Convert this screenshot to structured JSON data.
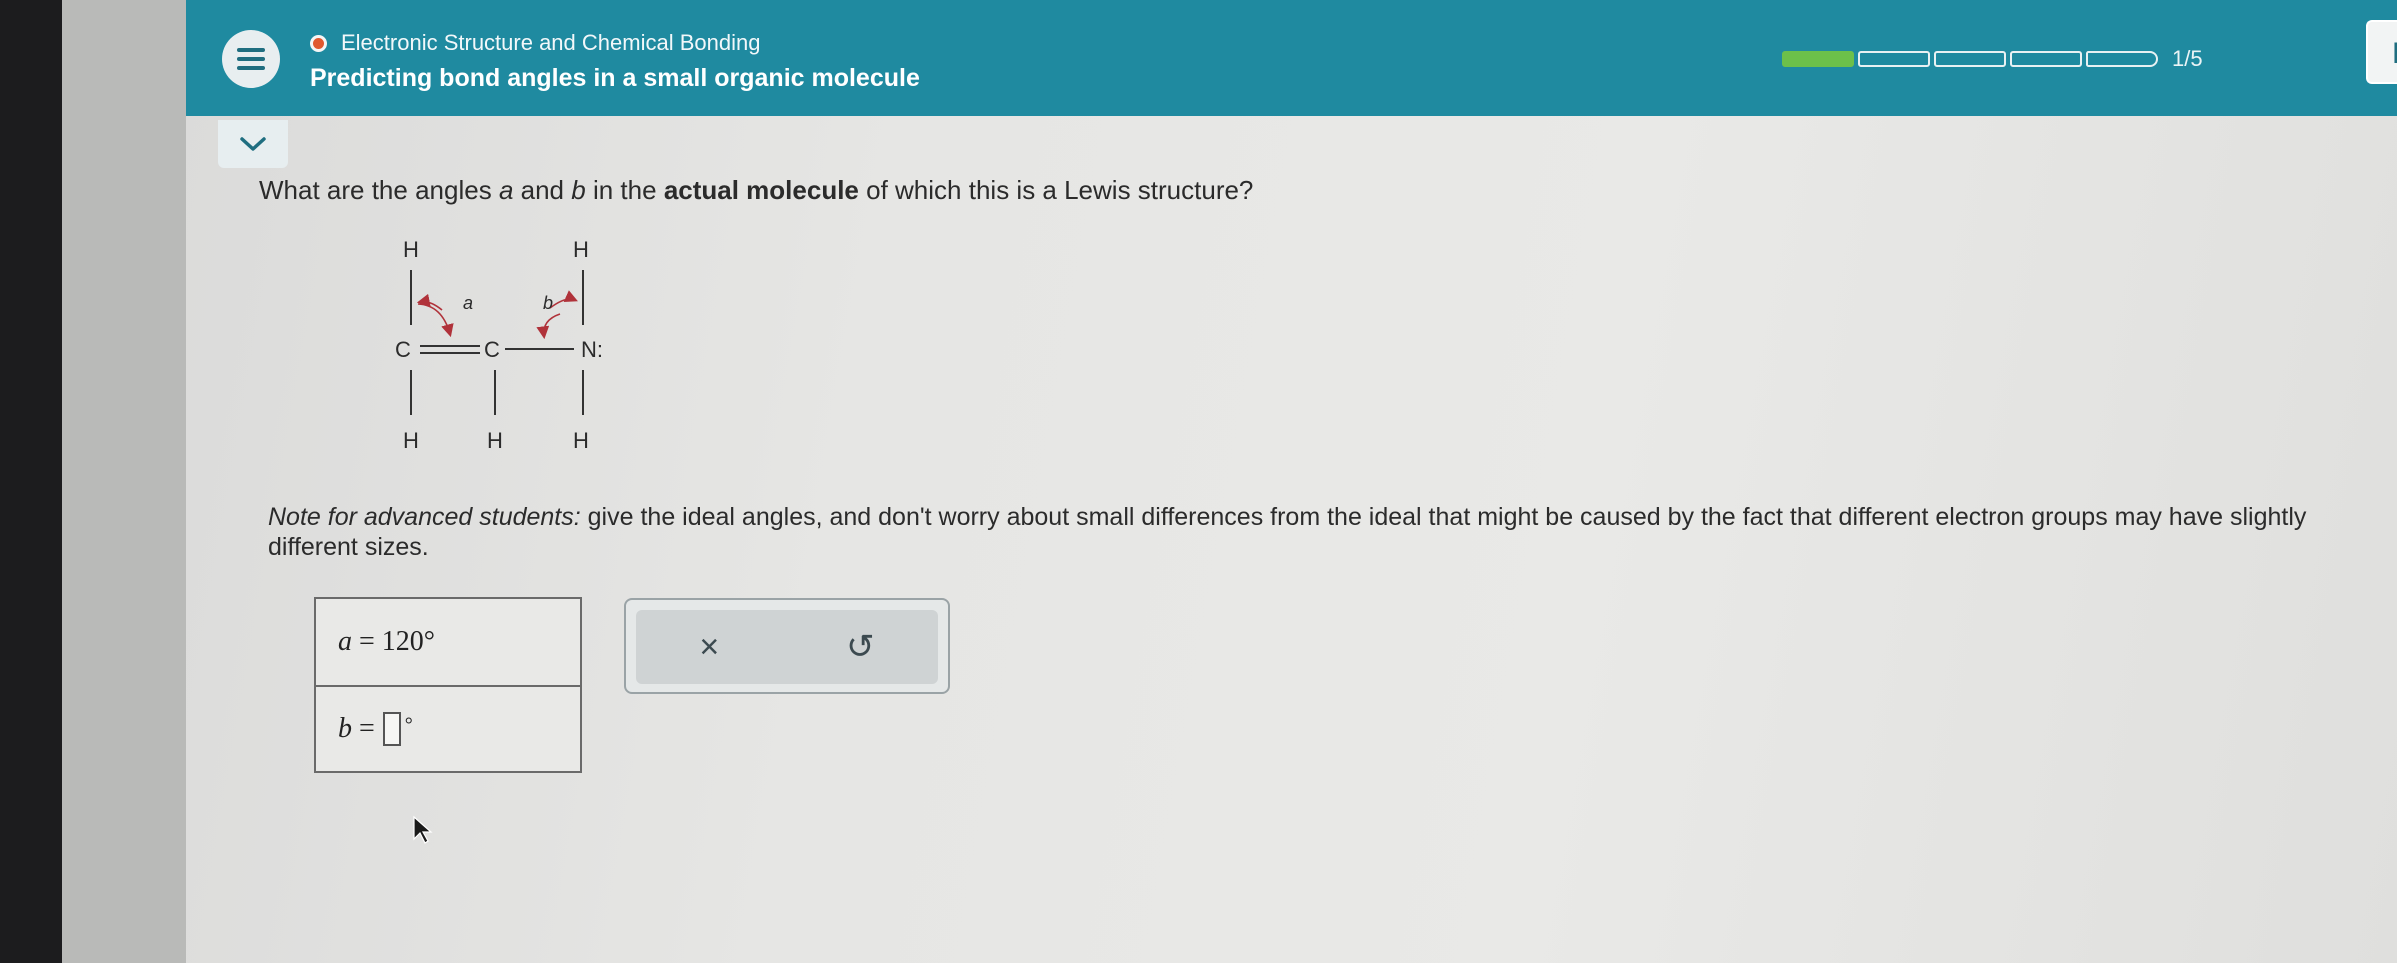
{
  "header": {
    "topic": "Electronic Structure and Chemical Bonding",
    "subtitle": "Predicting bond angles in a small organic molecule",
    "progress": {
      "completed": 1,
      "total": 5,
      "label": "1/5"
    },
    "right_button_label": "Prak"
  },
  "question": {
    "prefix": "What are the angles",
    "var_a": "a",
    "and": "and",
    "var_b": "b",
    "mid": "in the",
    "bold": "actual molecule",
    "suffix": "of which this is a Lewis structure?"
  },
  "molecule": {
    "atoms": [
      "H",
      "H",
      "C",
      "C",
      "N:",
      "H",
      "H",
      "H"
    ],
    "angle_labels": [
      "a",
      "b"
    ]
  },
  "note": {
    "lead": "Note for advanced students:",
    "text": "give the ideal angles, and don't worry about small differences from the ideal that might be caused by the fact that different electron groups may have slightly different sizes."
  },
  "answers": {
    "a_var": "a",
    "a_value": "= 120°",
    "b_var": "b",
    "b_equals": "=",
    "b_value": "",
    "b_unit": "°"
  },
  "tools": {
    "clear_icon": "×",
    "undo_icon": "↺"
  },
  "colors": {
    "header_bg": "#1f8aa0",
    "progress_done": "#6cc04a",
    "angle_arrow": "#b0323a",
    "topic_dot": "#e0582f"
  }
}
